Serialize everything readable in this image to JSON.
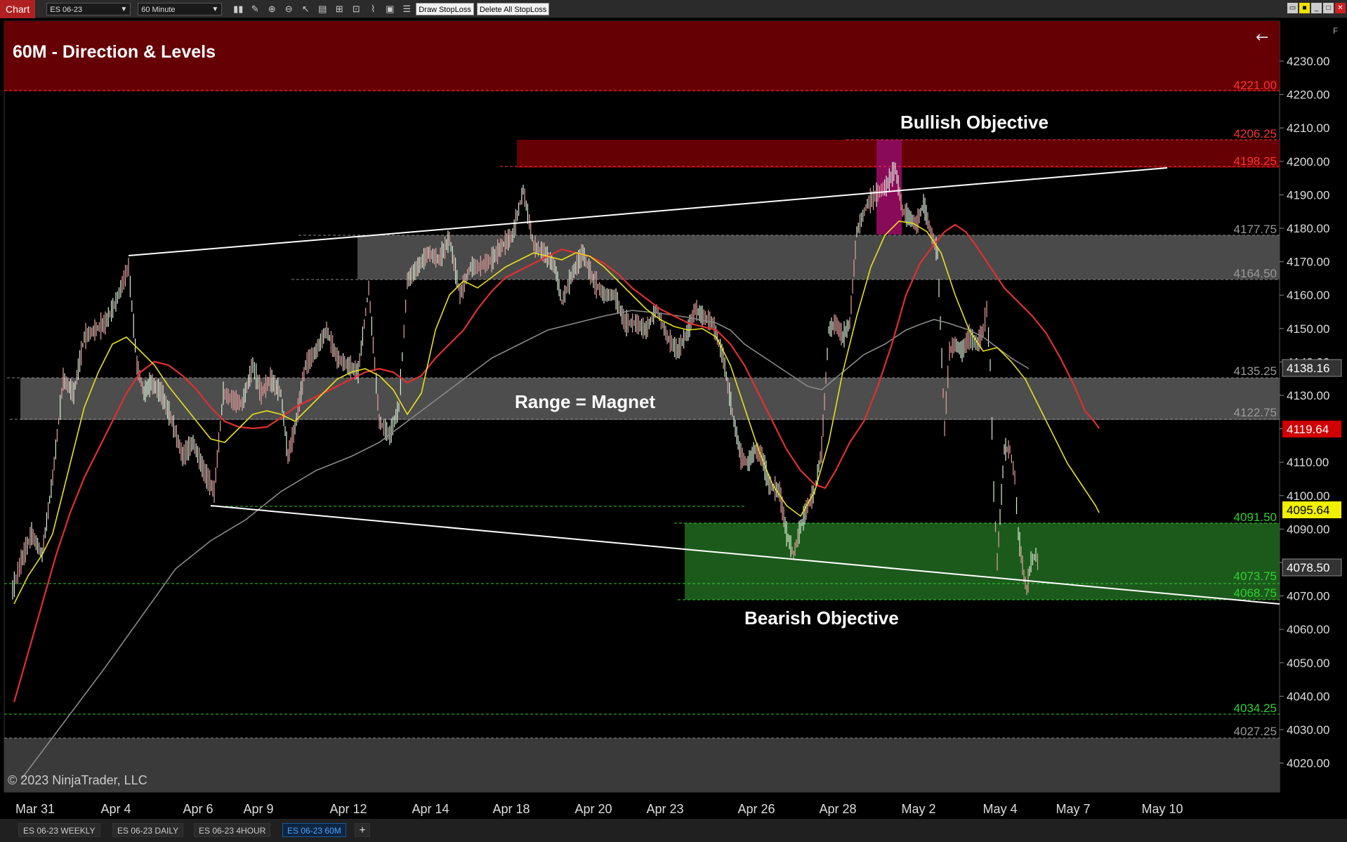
{
  "toolbar": {
    "app_tab": "Chart",
    "instrument": "ES 06-23",
    "interval": "60 Minute",
    "draw_stoploss": "Draw StopLoss",
    "delete_stoploss": "Delete All StopLoss",
    "icons": [
      "bar-style-icon",
      "draw-pencil-icon",
      "zoom-in-icon",
      "zoom-out-icon",
      "pointer-icon",
      "properties-icon",
      "templates-icon",
      "strategies-icon",
      "indicators-icon",
      "data-box-icon",
      "list-icon"
    ]
  },
  "chart": {
    "title": "60M - Direction & Levels",
    "copyright": "© 2023 NinjaTrader, LLC",
    "annotations": {
      "bullish": "Bullish Objective",
      "range": "Range = Magnet",
      "bearish": "Bearish Objective"
    },
    "price_axis": [
      "4230.00",
      "4220.00",
      "4210.00",
      "4200.00",
      "4190.00",
      "4180.00",
      "4170.00",
      "4160.00",
      "4150.00",
      "4140.00",
      "4130.00",
      "4120.00",
      "4110.00",
      "4100.00",
      "4090.00",
      "4080.00",
      "4070.00",
      "4060.00",
      "4050.00",
      "4040.00",
      "4030.00",
      "4020.00"
    ],
    "date_axis": [
      "Mar 31",
      "Apr 4",
      "Apr 6",
      "Apr 9",
      "Apr 12",
      "Apr 14",
      "Apr 18",
      "Apr 20",
      "Apr 23",
      "Apr 26",
      "Apr 28",
      "May 2",
      "May 4",
      "May 7",
      "May 10"
    ],
    "level_labels": {
      "l4221": "4221.00",
      "l4206": "4206.25",
      "l4198": "4198.25",
      "l4177": "4177.75",
      "l4164": "4164.50",
      "l4135": "4135.25",
      "l4122": "4122.75",
      "l4091": "4091.50",
      "l4073": "4073.75",
      "l4068": "4068.75",
      "l4034": "4034.25",
      "l4027": "4027.25"
    },
    "price_markers": {
      "p1": "4138.16",
      "p2": "4119.64",
      "p3": "4095.64",
      "p4": "4078.50"
    },
    "colors": {
      "resistance": "#6b0000",
      "support": "#1a5e1a",
      "range": "#555555",
      "sma_fast": "#e8e020",
      "sma_mid": "#e03030",
      "sma_slow": "#8a8a8a"
    }
  },
  "bottom_tabs": [
    "ES 06-23 WEEKLY",
    "ES 06-23 DAILY",
    "ES 06-23 4HOUR",
    "ES 06-23 60M"
  ],
  "active_tab": "ES 06-23 60M"
}
